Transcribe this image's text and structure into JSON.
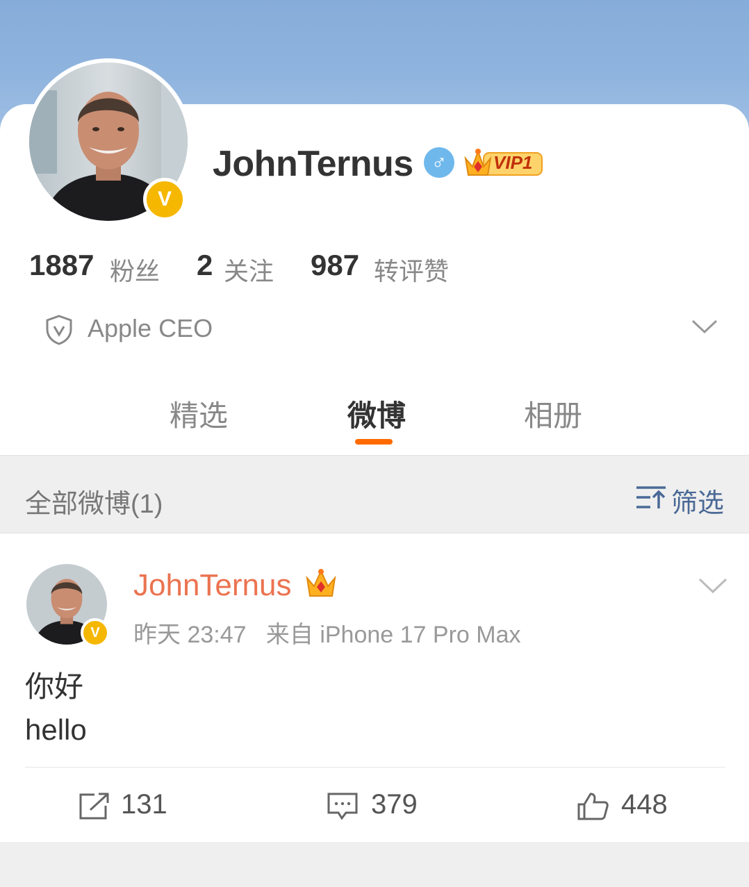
{
  "profile": {
    "name": "JohnTernus",
    "gender_symbol": "♂",
    "vip_label": "VIP1",
    "verified_badge": "V",
    "stats": [
      {
        "value": "1887",
        "label": "粉丝"
      },
      {
        "value": "2",
        "label": "关注"
      },
      {
        "value": "987",
        "label": "转评赞"
      }
    ],
    "bio": "Apple CEO"
  },
  "tabs": [
    {
      "label": "精选",
      "active": false
    },
    {
      "label": "微博",
      "active": true
    },
    {
      "label": "相册",
      "active": false
    }
  ],
  "filter_bar": {
    "count_label": "全部微博(1)",
    "filter_label": "筛选"
  },
  "post": {
    "author": "JohnTernus",
    "verified_badge": "V",
    "meta": "昨天 23:47   来自 iPhone 17 Pro Max",
    "text_line1": "你好",
    "text_line2": "hello",
    "actions": {
      "repost_count": "131",
      "comment_count": "379",
      "like_count": "448"
    }
  },
  "colors": {
    "accent_orange": "#ff6a00",
    "author_orange": "#eb7350",
    "verified_yellow": "#f5b700",
    "gender_blue": "#6fb8ec",
    "filter_blue": "#4a6a96"
  },
  "icons": [
    "shield-v-icon",
    "chevron-down-icon",
    "filter-sort-icon",
    "crown-icon",
    "repost-icon",
    "comment-icon",
    "like-icon"
  ]
}
